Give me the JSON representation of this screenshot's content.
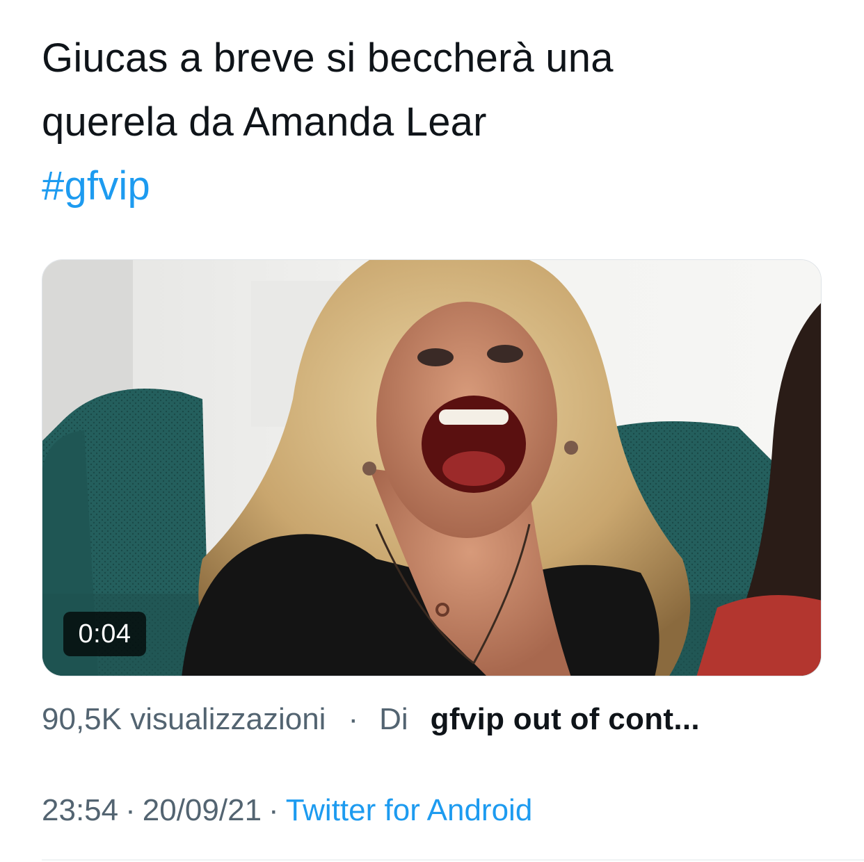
{
  "tweet": {
    "text_line_1": "Giucas a breve si beccherà una",
    "text_line_2": "querela da Amanda Lear",
    "hashtag": "#gfvip"
  },
  "media": {
    "type": "video",
    "duration": "0:04"
  },
  "stats": {
    "views": "90,5K visualizzazioni",
    "separator": "·",
    "by_label": "Di",
    "author": "gfvip out of cont..."
  },
  "meta": {
    "time": "23:54",
    "separator_1": "·",
    "date": "20/09/21",
    "separator_2": "·",
    "source": "Twitter for Android"
  },
  "colors": {
    "link": "#1d9bf0",
    "text": "#0f1419",
    "secondary": "#536471"
  }
}
